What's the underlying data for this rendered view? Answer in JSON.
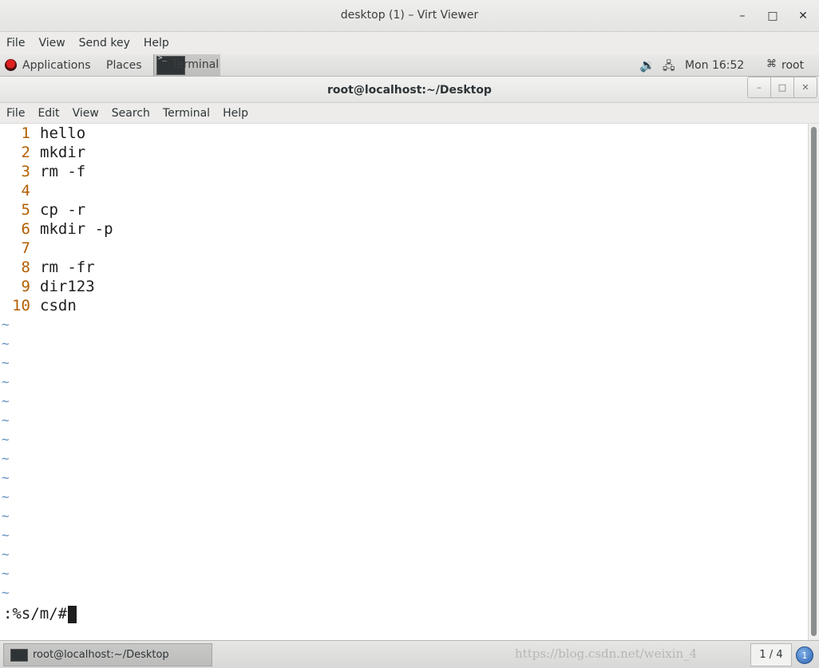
{
  "viewer": {
    "title": "desktop (1) – Virt Viewer",
    "menu": [
      "File",
      "View",
      "Send key",
      "Help"
    ]
  },
  "panel": {
    "applications": "Applications",
    "places": "Places",
    "task_label": "Terminal",
    "clock": "Mon 16:52",
    "user": "root"
  },
  "terminal": {
    "title": "root@localhost:~/Desktop",
    "menu": [
      "File",
      "Edit",
      "View",
      "Search",
      "Terminal",
      "Help"
    ],
    "lines": [
      {
        "num": "1",
        "text": "hello"
      },
      {
        "num": "2",
        "text": "mkdir"
      },
      {
        "num": "3",
        "text": "rm -f"
      },
      {
        "num": "4",
        "text": ""
      },
      {
        "num": "5",
        "text": "cp -r"
      },
      {
        "num": "6",
        "text": "mkdir -p"
      },
      {
        "num": "7",
        "text": ""
      },
      {
        "num": "8",
        "text": "rm -fr"
      },
      {
        "num": "9",
        "text": "dir123"
      },
      {
        "num": "10",
        "text": "csdn"
      }
    ],
    "tilde": "~",
    "tilde_count": 15,
    "command": ":%s/m/#"
  },
  "taskbar": {
    "window_label": "root@localhost:~/Desktop",
    "watermark": "https://blog.csdn.net/weixin_4",
    "pager": "1 / 4",
    "notification_count": "1"
  },
  "colors": {
    "line_number": "#b35f00",
    "tilde": "#5f8fbf"
  }
}
